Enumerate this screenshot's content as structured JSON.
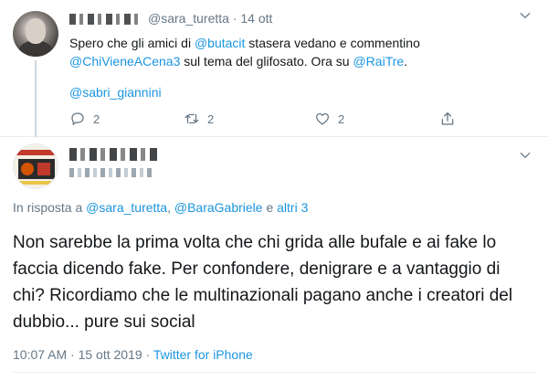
{
  "tweet1": {
    "handle": "@sara_turetta",
    "separator": "·",
    "date": "14 ott",
    "line1_pre": "Spero che gli amici di ",
    "line1_mention": "@butacit",
    "line1_post": " stasera vedano e commentino",
    "line2_mention": "@ChiVieneACena3",
    "line2_mid": " sul tema del glifosato. Ora su ",
    "line2_mention2": "@RaiTre",
    "line2_post": ".",
    "trailing_mention": "@sabri_giannini",
    "actions": {
      "reply_count": "2",
      "retweet_count": "2",
      "like_count": "2"
    }
  },
  "tweet2": {
    "reply_prefix": "In risposta a ",
    "reply_user1": "@sara_turetta",
    "reply_sep": ", ",
    "reply_user2": "@BaraGabriele",
    "reply_and": " e ",
    "reply_others": "altri 3",
    "text": "Non sarebbe la prima volta che chi grida alle bufale e ai fake lo faccia dicendo fake. Per confondere, denigrare e a vantaggio di chi? Ricordiamo che le multinazionali pagano anche i creatori del dubbio... pure sui social",
    "time_date": "10:07 AM · 15 ott 2019 · ",
    "source": "Twitter for iPhone"
  },
  "icons": [
    "chevron-down-icon",
    "reply-icon",
    "retweet-icon",
    "like-icon",
    "share-icon"
  ],
  "colors": {
    "link": "#1b95e0",
    "muted": "#657786",
    "text": "#14171a",
    "divider": "#e6ecf0"
  }
}
